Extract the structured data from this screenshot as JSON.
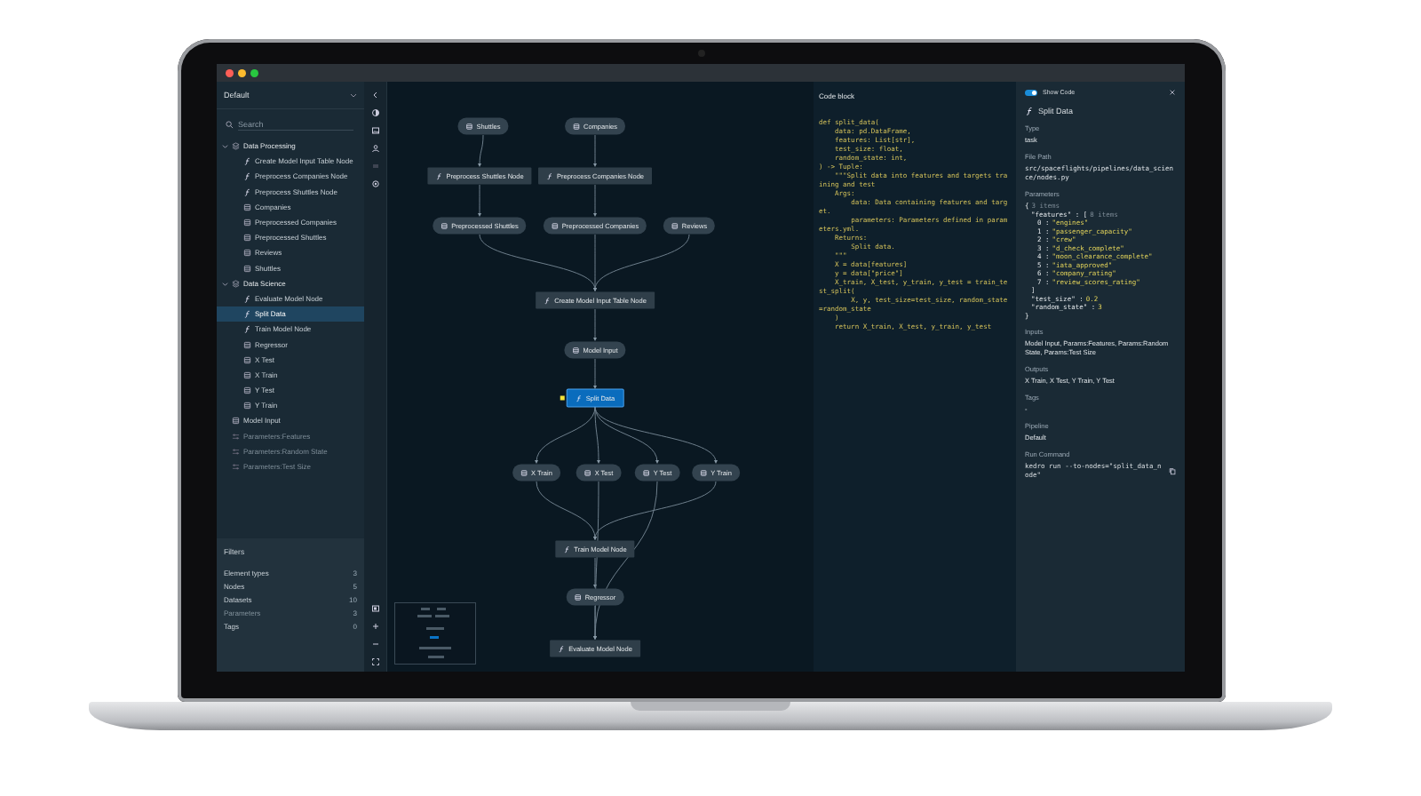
{
  "window": {
    "dots": [
      {
        "color": "#ff5f57"
      },
      {
        "color": "#febc2e"
      },
      {
        "color": "#28c840"
      }
    ]
  },
  "sidebar": {
    "pipeline": "Default",
    "search": {
      "placeholder": "Search"
    },
    "tree": [
      {
        "label": "Data Processing",
        "kind": "group",
        "expanded": true,
        "selected": false,
        "disabled": false,
        "children": [
          {
            "label": "Create Model Input Table Node",
            "kind": "task",
            "selected": false,
            "disabled": false
          },
          {
            "label": "Preprocess Companies Node",
            "kind": "task",
            "selected": false,
            "disabled": false
          },
          {
            "label": "Preprocess Shuttles Node",
            "kind": "task",
            "selected": false,
            "disabled": false
          },
          {
            "label": "Companies",
            "kind": "data",
            "selected": false,
            "disabled": false
          },
          {
            "label": "Preprocessed Companies",
            "kind": "data",
            "selected": false,
            "disabled": false
          },
          {
            "label": "Preprocessed Shuttles",
            "kind": "data",
            "selected": false,
            "disabled": false
          },
          {
            "label": "Reviews",
            "kind": "data",
            "selected": false,
            "disabled": false
          },
          {
            "label": "Shuttles",
            "kind": "data",
            "selected": false,
            "disabled": false
          }
        ]
      },
      {
        "label": "Data Science",
        "kind": "group",
        "expanded": true,
        "selected": false,
        "disabled": false,
        "children": [
          {
            "label": "Evaluate Model Node",
            "kind": "task",
            "selected": false,
            "disabled": false
          },
          {
            "label": "Split Data",
            "kind": "task",
            "selected": true,
            "disabled": false
          },
          {
            "label": "Train Model Node",
            "kind": "task",
            "selected": false,
            "disabled": false
          },
          {
            "label": "Regressor",
            "kind": "data",
            "selected": false,
            "disabled": false
          },
          {
            "label": "X Test",
            "kind": "data",
            "selected": false,
            "disabled": false
          },
          {
            "label": "X Train",
            "kind": "data",
            "selected": false,
            "disabled": false
          },
          {
            "label": "Y Test",
            "kind": "data",
            "selected": false,
            "disabled": false
          },
          {
            "label": "Y Train",
            "kind": "data",
            "selected": false,
            "disabled": false
          }
        ]
      },
      {
        "label": "Model Input",
        "kind": "data",
        "selected": false,
        "disabled": false
      },
      {
        "label": "Parameters:Features",
        "kind": "parameter",
        "selected": false,
        "disabled": true
      },
      {
        "label": "Parameters:Random State",
        "kind": "parameter",
        "selected": false,
        "disabled": true
      },
      {
        "label": "Parameters:Test Size",
        "kind": "parameter",
        "selected": false,
        "disabled": true
      }
    ],
    "filters": {
      "title": "Filters",
      "rows": [
        {
          "label": "Element types",
          "count": "3",
          "disabled": false
        },
        {
          "label": "Nodes",
          "count": "5",
          "disabled": false
        },
        {
          "label": "Datasets",
          "count": "10",
          "disabled": false
        },
        {
          "label": "Parameters",
          "count": "3",
          "disabled": true
        },
        {
          "label": "Tags",
          "count": "0",
          "disabled": false
        }
      ]
    }
  },
  "graph": {
    "nodes": [
      {
        "label": "Shuttles",
        "kind": "data",
        "selected": false
      },
      {
        "label": "Companies",
        "kind": "data",
        "selected": false
      },
      {
        "label": "Preprocess Shuttles Node",
        "kind": "task",
        "selected": false
      },
      {
        "label": "Preprocess Companies Node",
        "kind": "task",
        "selected": false
      },
      {
        "label": "Preprocessed Shuttles",
        "kind": "data",
        "selected": false
      },
      {
        "label": "Preprocessed Companies",
        "kind": "data",
        "selected": false
      },
      {
        "label": "Reviews",
        "kind": "data",
        "selected": false
      },
      {
        "label": "Create Model Input Table Node",
        "kind": "task",
        "selected": false
      },
      {
        "label": "Model Input",
        "kind": "data",
        "selected": false
      },
      {
        "label": "Split Data",
        "kind": "task",
        "selected": true
      },
      {
        "label": "X Train",
        "kind": "data",
        "selected": false
      },
      {
        "label": "X Test",
        "kind": "data",
        "selected": false
      },
      {
        "label": "Y Test",
        "kind": "data",
        "selected": false
      },
      {
        "label": "Y Train",
        "kind": "data",
        "selected": false
      },
      {
        "label": "Train Model Node",
        "kind": "task",
        "selected": false
      },
      {
        "label": "Regressor",
        "kind": "data",
        "selected": false
      },
      {
        "label": "Evaluate Model Node",
        "kind": "task",
        "selected": false
      }
    ]
  },
  "code": {
    "title": "Code block",
    "lines": [
      "def split_data(",
      "    data: pd.DataFrame,",
      "    features: List[str],",
      "    test_size: float,",
      "    random_state: int,",
      ") -> Tuple:",
      "    \"\"\"Split data into features and targets training and test",
      "    Args:",
      "        data: Data containing features and target.",
      "        parameters: Parameters defined in parameters.yml.",
      "    Returns:",
      "        Split data.",
      "    \"\"\"",
      "    X = data[features]",
      "    y = data[\"price\"]",
      "    X_train, X_test, y_train, y_test = train_test_split(",
      "        X, y, test_size=test_size, random_state=random_state",
      "    )",
      "    return X_train, X_test, y_train, y_test"
    ]
  },
  "metadata": {
    "show_code": {
      "label": "Show Code",
      "on": true
    },
    "title": "Split Data",
    "fields": [
      {
        "label": "Type",
        "kind": "text",
        "value": "task"
      },
      {
        "label": "File Path",
        "kind": "code",
        "value": "src/spaceflights/pipelines/data_science/nodes.py"
      },
      {
        "label": "Parameters",
        "kind": "json",
        "tree": [
          {
            "key": "{",
            "note": "3 items",
            "close": "}",
            "children": [
              {
                "key": "\"features\" : [",
                "note": "8 items",
                "close": "]",
                "children": [
                  {
                    "key": "0 :",
                    "value": "\"engines\""
                  },
                  {
                    "key": "1 :",
                    "value": "\"passenger_capacity\""
                  },
                  {
                    "key": "2 :",
                    "value": "\"crew\""
                  },
                  {
                    "key": "3 :",
                    "value": "\"d_check_complete\""
                  },
                  {
                    "key": "4 :",
                    "value": "\"moon_clearance_complete\""
                  },
                  {
                    "key": "5 :",
                    "value": "\"iata_approved\""
                  },
                  {
                    "key": "6 :",
                    "value": "\"company_rating\""
                  },
                  {
                    "key": "7 :",
                    "value": "\"review_scores_rating\""
                  }
                ]
              },
              {
                "key": "\"test_size\" :",
                "value": "0.2"
              },
              {
                "key": "\"random_state\" :",
                "value": "3"
              }
            ]
          }
        ]
      },
      {
        "label": "Inputs",
        "kind": "text",
        "value": "Model Input, Params:Features, Params:Random State, Params:Test Size"
      },
      {
        "label": "Outputs",
        "kind": "text",
        "value": "X Train, X Test, Y Train, Y Test"
      },
      {
        "label": "Tags",
        "kind": "text",
        "value": "-"
      },
      {
        "label": "Pipeline",
        "kind": "text",
        "value": "Default"
      },
      {
        "label": "Run Command",
        "kind": "command",
        "value": "kedro run --to-nodes=\"split_data_node\""
      }
    ]
  }
}
